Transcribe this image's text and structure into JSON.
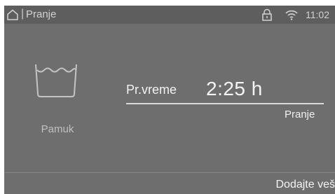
{
  "status_bar": {
    "separator": "|",
    "title": "Pranje",
    "time": "11:02",
    "icons": [
      "home-icon",
      "lock-icon",
      "wifi-icon"
    ]
  },
  "program": {
    "icon": "basin-icon",
    "name": "Pamuk"
  },
  "duration": {
    "label": "Pr.vreme",
    "value": "2:25  h",
    "status": "Pranje"
  },
  "footer": {
    "action_label": "Dodajte veš"
  },
  "colors": {
    "panel": "#6e6e6e",
    "status_bar": "#5e5e5e",
    "text": "#f2f2f2",
    "muted_text": "#c0c0c0"
  }
}
